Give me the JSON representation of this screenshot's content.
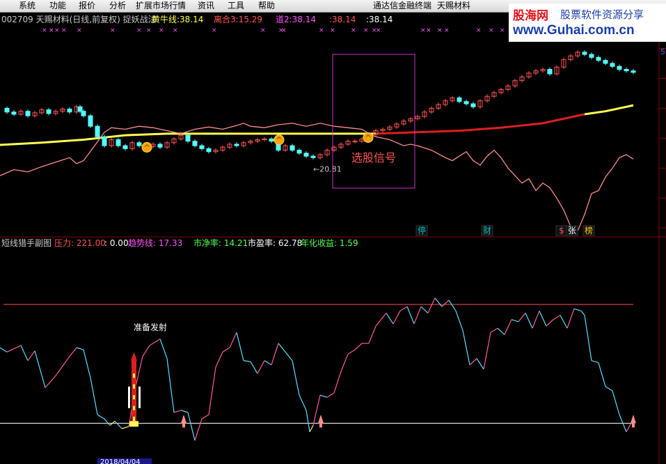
{
  "menu": {
    "items": [
      "系统",
      "功能",
      "报价",
      "分析",
      "扩展市场行情",
      "资讯",
      "工具",
      "帮助"
    ],
    "right_items": [
      "通达信金融终端",
      "天赐材料"
    ]
  },
  "main_panel": {
    "title": "002709 天赐材料(日线,前复权) 捉妖战法",
    "indicators": [
      {
        "label": "黄牛线:",
        "value": "38.14",
        "color": "#ffff54"
      },
      {
        "label": "离合3:",
        "value": "15.29",
        "color": "#ff5454"
      },
      {
        "label": "道2:",
        "value": "38.14",
        "color": "#ff54ff"
      },
      {
        "label": ":",
        "value": "38.14",
        "color": "#ff5454"
      },
      {
        "label": ":",
        "value": "38.14",
        "color": "#ffffff"
      }
    ],
    "low_annotation": "←20.81",
    "signal_label": "选股信号",
    "axis_label": "5",
    "event_tags": [
      {
        "text": "停",
        "color": "#00c0c0"
      },
      {
        "text": "财",
        "color": "#00c0c0"
      },
      {
        "text": "$",
        "color": "#ff5454"
      },
      {
        "text": "张",
        "color": "#ffffff"
      },
      {
        "text": "榜",
        "color": "#ffcc00"
      }
    ]
  },
  "sub_panel": {
    "title": "短线猎手副图",
    "indicators": [
      {
        "label": "压力:",
        "value": "221.00",
        "color": "#ff5454"
      },
      {
        "label": ":",
        "value": "0.00",
        "color": "#ffffff"
      },
      {
        "label": "趋势线:",
        "value": "17.33",
        "color": "#ff54ff"
      },
      {
        "label": "市净率:",
        "value": "14.21",
        "color": "#54ff54"
      },
      {
        "label": "市盈率:",
        "value": "62.78",
        "color": "#ffffff"
      },
      {
        "label": "年化收益:",
        "value": "1.59",
        "color": "#54ff54"
      }
    ],
    "launch_label": "准备发射",
    "date_label": "2018/04/04"
  },
  "watermark": {
    "main": "股海网",
    "slogan": "股票软件资源分享",
    "url": "www.Guhai.com.cn"
  },
  "colors": {
    "background": "#000000",
    "grid": "#8b0000",
    "up_candle": "#ff5454",
    "down_candle": "#54ffff",
    "trend_pink": "#ff8c8c",
    "select_box": "#cc33cc"
  },
  "chart_data": {
    "type": "candlestick",
    "title": "002709 天赐材料(日线,前复权) 捉妖战法",
    "close_series": [
      {
        "name": "",
        "points": [
          [
            0,
            36.0
          ],
          [
            10,
            35.5
          ],
          [
            20,
            35.2
          ],
          [
            30,
            35.6
          ],
          [
            40,
            35.0
          ],
          [
            50,
            35.4
          ],
          [
            60,
            35.8
          ],
          [
            70,
            35.3
          ],
          [
            80,
            35.6
          ],
          [
            90,
            35.9
          ],
          [
            100,
            35.5
          ],
          [
            110,
            36.2
          ],
          [
            115,
            35.6
          ],
          [
            120,
            35.0
          ],
          [
            130,
            33.6
          ],
          [
            140,
            32.2
          ],
          [
            150,
            31.0
          ],
          [
            160,
            31.8
          ],
          [
            170,
            31.0
          ],
          [
            180,
            30.6
          ],
          [
            190,
            31.4
          ],
          [
            200,
            31.0
          ],
          [
            210,
            30.9
          ],
          [
            220,
            31.2
          ],
          [
            230,
            30.8
          ],
          [
            240,
            31.4
          ],
          [
            250,
            31.9
          ],
          [
            260,
            32.4
          ],
          [
            270,
            31.6
          ],
          [
            280,
            31.0
          ],
          [
            290,
            30.6
          ],
          [
            300,
            30.2
          ],
          [
            310,
            30.4
          ],
          [
            320,
            30.8
          ],
          [
            330,
            31.2
          ],
          [
            340,
            31.0
          ],
          [
            350,
            31.4
          ],
          [
            360,
            31.6
          ],
          [
            370,
            31.8
          ],
          [
            380,
            31.9
          ],
          [
            390,
            31.6
          ],
          [
            400,
            30.4
          ],
          [
            410,
            31.0
          ],
          [
            420,
            30.4
          ],
          [
            430,
            30.0
          ],
          [
            440,
            29.6
          ],
          [
            450,
            29.4
          ],
          [
            460,
            29.8
          ],
          [
            470,
            30.4
          ],
          [
            480,
            30.8
          ],
          [
            490,
            31.2
          ],
          [
            500,
            31.6
          ],
          [
            510,
            31.6
          ],
          [
            520,
            31.9
          ],
          [
            530,
            32.5
          ],
          [
            540,
            33.0
          ],
          [
            550,
            33.2
          ],
          [
            560,
            33.5
          ],
          [
            570,
            33.9
          ],
          [
            580,
            34.3
          ],
          [
            590,
            34.6
          ],
          [
            600,
            34.9
          ],
          [
            610,
            35.5
          ],
          [
            620,
            36.0
          ],
          [
            630,
            36.5
          ],
          [
            640,
            37.0
          ],
          [
            650,
            37.4
          ],
          [
            660,
            36.9
          ],
          [
            670,
            36.6
          ],
          [
            680,
            36.2
          ],
          [
            690,
            37.0
          ],
          [
            700,
            37.6
          ],
          [
            710,
            38.1
          ],
          [
            720,
            38.5
          ],
          [
            730,
            39.0
          ],
          [
            740,
            39.7
          ],
          [
            750,
            40.2
          ],
          [
            760,
            40.7
          ],
          [
            770,
            41.0
          ],
          [
            780,
            41.2
          ],
          [
            790,
            40.6
          ],
          [
            800,
            41.5
          ],
          [
            810,
            42.5
          ],
          [
            820,
            43.0
          ],
          [
            830,
            43.5
          ],
          [
            840,
            43.2
          ],
          [
            850,
            42.8
          ],
          [
            860,
            42.4
          ],
          [
            870,
            42.0
          ],
          [
            880,
            41.6
          ],
          [
            890,
            41.2
          ],
          [
            900,
            41.0
          ],
          [
            910,
            40.8
          ]
        ]
      }
    ],
    "trend_line_pink": [
      [
        0,
        27.0
      ],
      [
        20,
        27.8
      ],
      [
        40,
        27.5
      ],
      [
        60,
        28.2
      ],
      [
        80,
        28.8
      ],
      [
        100,
        29.4
      ],
      [
        110,
        28.6
      ],
      [
        120,
        29.0
      ],
      [
        140,
        31.5
      ],
      [
        150,
        32.8
      ],
      [
        160,
        33.4
      ],
      [
        180,
        33.2
      ],
      [
        200,
        33.6
      ],
      [
        220,
        33.4
      ],
      [
        240,
        33.0
      ],
      [
        260,
        32.6
      ],
      [
        280,
        33.2
      ],
      [
        300,
        33.5
      ],
      [
        320,
        33.2
      ],
      [
        340,
        33.7
      ],
      [
        350,
        34.0
      ],
      [
        360,
        33.6
      ],
      [
        380,
        33.4
      ],
      [
        400,
        33.8
      ],
      [
        420,
        34.0
      ],
      [
        440,
        33.6
      ],
      [
        460,
        34.0
      ],
      [
        480,
        33.6
      ],
      [
        500,
        33.4
      ],
      [
        520,
        33.2
      ],
      [
        530,
        32.6
      ],
      [
        540,
        32.2
      ],
      [
        560,
        31.8
      ],
      [
        580,
        31.0
      ],
      [
        590,
        31.2
      ],
      [
        600,
        31.0
      ],
      [
        620,
        30.4
      ],
      [
        640,
        29.4
      ],
      [
        650,
        29.0
      ],
      [
        660,
        29.6
      ],
      [
        670,
        30.2
      ],
      [
        680,
        29.0
      ],
      [
        690,
        28.4
      ],
      [
        700,
        29.6
      ],
      [
        710,
        30.4
      ],
      [
        720,
        29.4
      ],
      [
        730,
        28.0
      ],
      [
        740,
        27.0
      ],
      [
        750,
        26.0
      ],
      [
        760,
        26.6
      ],
      [
        770,
        25.0
      ],
      [
        780,
        26.0
      ],
      [
        790,
        25.4
      ],
      [
        800,
        24.0
      ],
      [
        810,
        22.4
      ],
      [
        820,
        20.2
      ],
      [
        830,
        19.6
      ],
      [
        840,
        21.8
      ],
      [
        850,
        24.6
      ],
      [
        860,
        25.0
      ],
      [
        870,
        26.8
      ],
      [
        880,
        28.0
      ],
      [
        890,
        29.4
      ],
      [
        900,
        29.8
      ],
      [
        910,
        29.2
      ]
    ],
    "ma_line": [
      [
        0,
        31.1
      ],
      [
        60,
        31.4
      ],
      [
        120,
        31.8
      ],
      [
        180,
        32.4
      ],
      [
        240,
        32.6
      ],
      [
        300,
        32.6
      ],
      [
        360,
        32.6
      ],
      [
        420,
        32.6
      ],
      [
        480,
        32.6
      ],
      [
        540,
        32.6
      ],
      [
        600,
        32.8
      ],
      [
        660,
        33.0
      ],
      [
        720,
        33.4
      ],
      [
        780,
        34.0
      ],
      [
        840,
        35.2
      ],
      [
        870,
        35.6
      ],
      [
        900,
        36.2
      ],
      [
        910,
        36.4
      ]
    ],
    "sub_line": [
      [
        0,
        100
      ],
      [
        10,
        96
      ],
      [
        30,
        102
      ],
      [
        40,
        88
      ],
      [
        50,
        97
      ],
      [
        65,
        63
      ],
      [
        80,
        74
      ],
      [
        100,
        92
      ],
      [
        110,
        100
      ],
      [
        120,
        98
      ],
      [
        130,
        72
      ],
      [
        140,
        38
      ],
      [
        150,
        34
      ],
      [
        158,
        28
      ],
      [
        165,
        32
      ],
      [
        175,
        25
      ],
      [
        185,
        27
      ],
      [
        195,
        64
      ],
      [
        205,
        92
      ],
      [
        215,
        102
      ],
      [
        230,
        108
      ],
      [
        240,
        90
      ],
      [
        250,
        40
      ],
      [
        260,
        42
      ],
      [
        270,
        40
      ],
      [
        280,
        14
      ],
      [
        290,
        34
      ],
      [
        300,
        38
      ],
      [
        310,
        82
      ],
      [
        320,
        96
      ],
      [
        330,
        100
      ],
      [
        340,
        114
      ],
      [
        350,
        88
      ],
      [
        360,
        87
      ],
      [
        370,
        76
      ],
      [
        380,
        88
      ],
      [
        390,
        84
      ],
      [
        400,
        104
      ],
      [
        410,
        96
      ],
      [
        420,
        88
      ],
      [
        430,
        56
      ],
      [
        440,
        42
      ],
      [
        445,
        22
      ],
      [
        450,
        28
      ],
      [
        460,
        56
      ],
      [
        470,
        54
      ],
      [
        480,
        58
      ],
      [
        490,
        78
      ],
      [
        500,
        94
      ],
      [
        510,
        98
      ],
      [
        520,
        104
      ],
      [
        530,
        104
      ],
      [
        540,
        120
      ],
      [
        555,
        132
      ],
      [
        565,
        122
      ],
      [
        575,
        134
      ],
      [
        585,
        138
      ],
      [
        595,
        122
      ],
      [
        605,
        138
      ],
      [
        615,
        132
      ],
      [
        625,
        146
      ],
      [
        635,
        138
      ],
      [
        645,
        144
      ],
      [
        655,
        134
      ],
      [
        665,
        116
      ],
      [
        675,
        84
      ],
      [
        685,
        90
      ],
      [
        695,
        80
      ],
      [
        705,
        114
      ],
      [
        715,
        118
      ],
      [
        725,
        112
      ],
      [
        735,
        126
      ],
      [
        745,
        124
      ],
      [
        755,
        132
      ],
      [
        765,
        118
      ],
      [
        775,
        134
      ],
      [
        785,
        120
      ],
      [
        795,
        126
      ],
      [
        805,
        130
      ],
      [
        815,
        118
      ],
      [
        825,
        136
      ],
      [
        835,
        134
      ],
      [
        840,
        130
      ],
      [
        850,
        88
      ],
      [
        860,
        86
      ],
      [
        870,
        64
      ],
      [
        880,
        60
      ],
      [
        890,
        38
      ],
      [
        900,
        22
      ],
      [
        910,
        34
      ]
    ],
    "signal_box": {
      "x_from": 478,
      "x_to": 596,
      "label": "选股信号"
    },
    "xlim": [
      0,
      957
    ],
    "main_ylim": [
      19,
      46
    ],
    "sub_ylim": [
      0,
      160
    ],
    "sub_ref_levels": [
      30,
      140
    ],
    "grid": true,
    "legend": "none"
  }
}
